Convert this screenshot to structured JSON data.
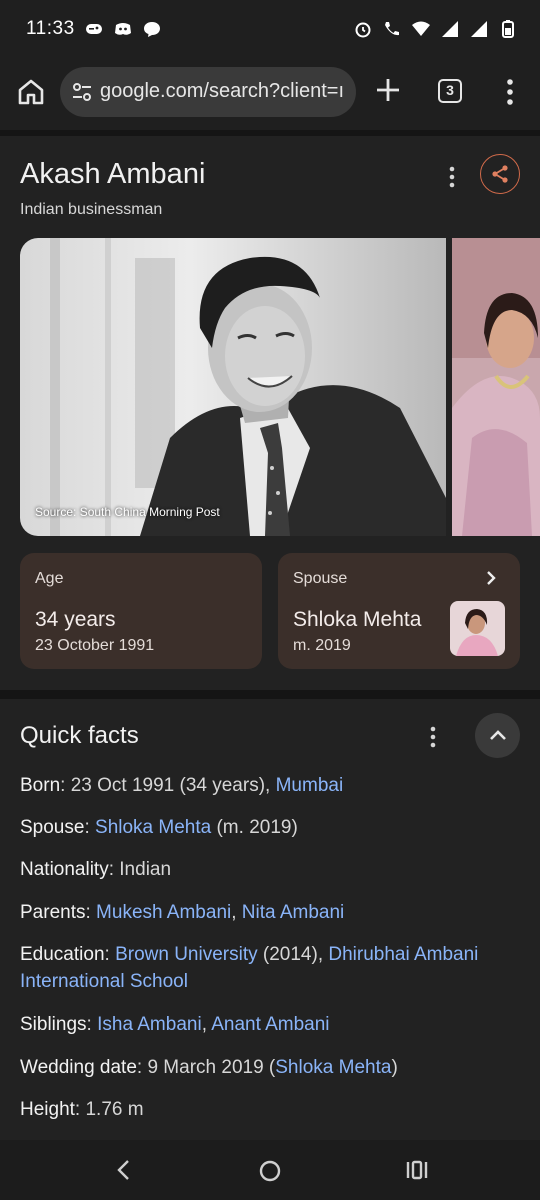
{
  "status_bar": {
    "time": "11:33",
    "left_icons": [
      "gamepad-icon",
      "discord-icon",
      "chat-bubble-icon"
    ],
    "right_icons": [
      "alarm-icon",
      "wifi-call-icon",
      "wifi-icon",
      "signal-icon",
      "signal-icon",
      "battery-icon"
    ]
  },
  "browser": {
    "url": "google.com/search?client=ı",
    "tab_count": "3"
  },
  "knowledge_panel": {
    "title": "Akash Ambani",
    "subtitle": "Indian businessman",
    "image_caption": "Source: South China Morning Post",
    "age_card": {
      "label": "Age",
      "value": "34 years",
      "sub": "23 October 1991"
    },
    "spouse_card": {
      "label": "Spouse",
      "value": "Shloka Mehta",
      "sub": "m. 2019"
    }
  },
  "quick_facts": {
    "title": "Quick facts",
    "born": {
      "key": "Born",
      "text": ": 23 Oct 1991 (34 years), ",
      "link": "Mumbai"
    },
    "spouse": {
      "key": "Spouse",
      "sep": ": ",
      "link": "Shloka Mehta",
      "text": " (m. 2019)"
    },
    "nationality": {
      "key": "Nationality",
      "text": ": Indian"
    },
    "parents": {
      "key": "Parents",
      "sep": ": ",
      "link1": "Mukesh Ambani",
      "comma": ", ",
      "link2": "Nita Ambani"
    },
    "education": {
      "key": "Education",
      "sep": ": ",
      "link1": "Brown University",
      "text": " (2014), ",
      "link2": "Dhirubhai Ambani International School"
    },
    "siblings": {
      "key": "Siblings",
      "sep": ": ",
      "link1": "Isha Ambani",
      "comma": ", ",
      "link2": "Anant Ambani"
    },
    "wedding": {
      "key": "Wedding date",
      "text": ": 9 March 2019 (",
      "link": "Shloka Mehta",
      "close": ")"
    },
    "height": {
      "key": "Height",
      "text": ": 1.76 m"
    }
  },
  "colors": {
    "link": "#8ab4f8",
    "card_bg": "#3b2f2a",
    "panel_bg": "#222222",
    "share_accent": "#d06a4a"
  }
}
